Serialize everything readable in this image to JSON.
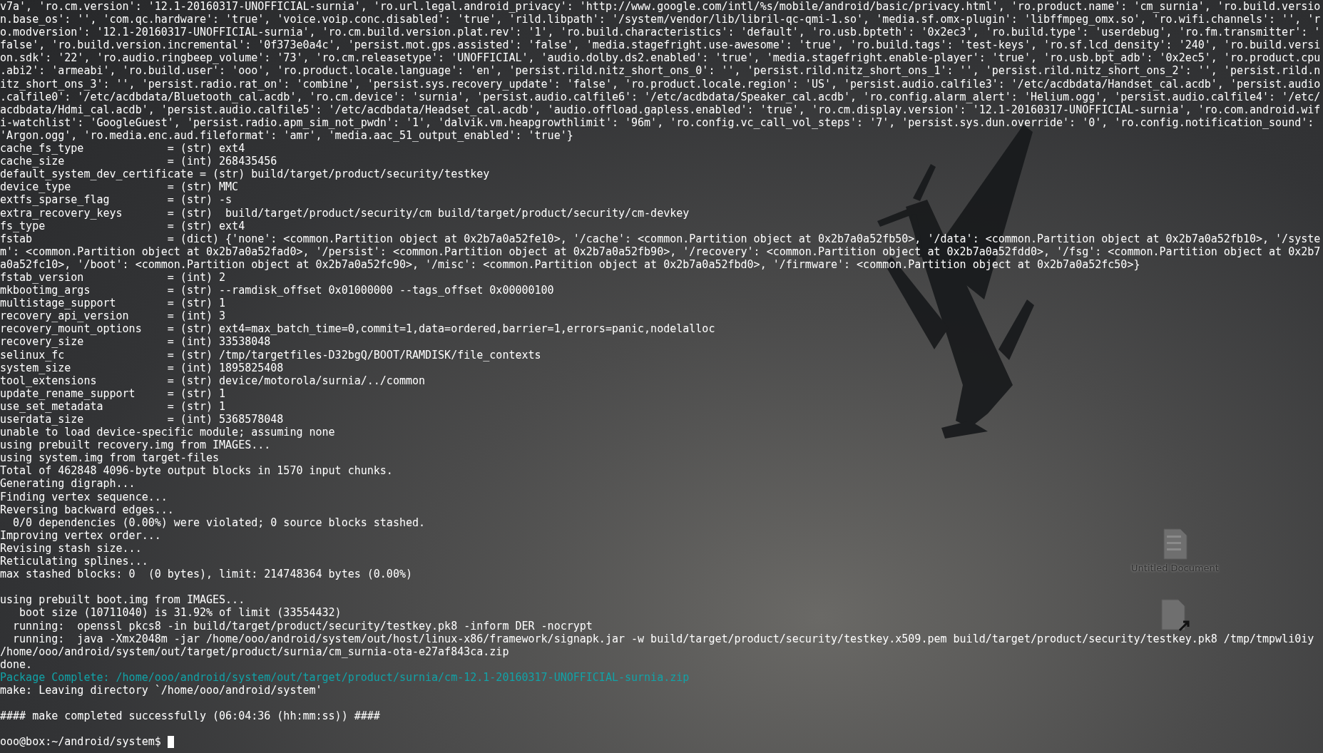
{
  "desktop": {
    "icons": [
      {
        "kind": "text-file",
        "label": "Untitled Document"
      },
      {
        "kind": "link-file"
      }
    ]
  },
  "terminal": {
    "lines": [
      {
        "kind": "plain",
        "text": "v7a', 'ro.cm.version': '12.1-20160317-UNOFFICIAL-surnia', 'ro.url.legal.android_privacy': 'http://www.google.com/intl/%s/mobile/android/basic/privacy.html', 'ro.product.name': 'cm_surnia', 'ro.build.versio"
      },
      {
        "kind": "plain",
        "text": "n.base_os': '', 'com.qc.hardware': 'true', 'voice.voip.conc.disabled': 'true', 'rild.libpath': '/system/vendor/lib/libril-qc-qmi-1.so', 'media.sf.omx-plugin': 'libffmpeg_omx.so', 'ro.wifi.channels': '', 'r"
      },
      {
        "kind": "plain",
        "text": "o.modversion': '12.1-20160317-UNOFFICIAL-surnia', 'ro.cm.build.version.plat.rev': '1', 'ro.build.characteristics': 'default', 'ro.usb.bpteth': '0x2ec3', 'ro.build.type': 'userdebug', 'ro.fm.transmitter': '"
      },
      {
        "kind": "plain",
        "text": "false', 'ro.build.version.incremental': '0f373e0a4c', 'persist.mot.gps.assisted': 'false', 'media.stagefright.use-awesome': 'true', 'ro.build.tags': 'test-keys', 'ro.sf.lcd_density': '240', 'ro.build.versi"
      },
      {
        "kind": "plain",
        "text": "on.sdk': '22', 'ro.audio.ringbeep_volume': '73', 'ro.cm.releasetype': 'UNOFFICIAL', 'audio.dolby.ds2.enabled': 'true', 'media.stagefright.enable-player': 'true', 'ro.usb.bpt_adb': '0x2ec5', 'ro.product.cpu"
      },
      {
        "kind": "plain",
        "text": ".abi2': 'armeabi', 'ro.build.user': 'ooo', 'ro.product.locale.language': 'en', 'persist.rild.nitz_short_ons_0': '', 'persist.rild.nitz_short_ons_1': '', 'persist.rild.nitz_short_ons_2': '', 'persist.rild.n"
      },
      {
        "kind": "plain",
        "text": "itz_short_ons_3': '', 'persist.radio.rat_on': 'combine', 'persist.sys.recovery_update': 'false', 'ro.product.locale.region': 'US', 'persist.audio.calfile3': '/etc/acdbdata/Handset_cal.acdb', 'persist.audio"
      },
      {
        "kind": "plain",
        "text": ".calfile0': '/etc/acdbdata/Bluetooth_cal.acdb', 'ro.cm.device': 'surnia', 'persist.audio.calfile6': '/etc/acdbdata/Speaker_cal.acdb', 'ro.config.alarm_alert': 'Helium.ogg', 'persist.audio.calfile4': '/etc/"
      },
      {
        "kind": "plain",
        "text": "acdbdata/Hdmi_cal.acdb', 'persist.audio.calfile5': '/etc/acdbdata/Headset_cal.acdb', 'audio.offload.gapless.enabled': 'true', 'ro.cm.display.version': '12.1-20160317-UNOFFICIAL-surnia', 'ro.com.android.wif"
      },
      {
        "kind": "plain",
        "text": "i-watchlist': 'GoogleGuest', 'persist.radio.apm_sim_not_pwdn': '1', 'dalvik.vm.heapgrowthlimit': '96m', 'ro.config.vc_call_vol_steps': '7', 'persist.sys.dun.override': '0', 'ro.config.notification_sound':"
      },
      {
        "kind": "plain",
        "text": "'Argon.ogg', 'ro.media.enc.aud.fileformat': 'amr', 'media.aac_51_output_enabled': 'true'}"
      },
      {
        "kind": "plain",
        "text": "cache_fs_type             = (str) ext4"
      },
      {
        "kind": "plain",
        "text": "cache_size                = (int) 268435456"
      },
      {
        "kind": "plain",
        "text": "default_system_dev_certificate = (str) build/target/product/security/testkey"
      },
      {
        "kind": "plain",
        "text": "device_type               = (str) MMC"
      },
      {
        "kind": "plain",
        "text": "extfs_sparse_flag         = (str) -s"
      },
      {
        "kind": "plain",
        "text": "extra_recovery_keys       = (str)  build/target/product/security/cm build/target/product/security/cm-devkey"
      },
      {
        "kind": "plain",
        "text": "fs_type                   = (str) ext4"
      },
      {
        "kind": "plain",
        "text": "fstab                     = (dict) {'none': <common.Partition object at 0x2b7a0a52fe10>, '/cache': <common.Partition object at 0x2b7a0a52fb50>, '/data': <common.Partition object at 0x2b7a0a52fb10>, '/syste"
      },
      {
        "kind": "plain",
        "text": "m': <common.Partition object at 0x2b7a0a52fad0>, '/persist': <common.Partition object at 0x2b7a0a52fb90>, '/recovery': <common.Partition object at 0x2b7a0a52fdd0>, '/fsg': <common.Partition object at 0x2b7"
      },
      {
        "kind": "plain",
        "text": "a0a52fc10>, '/boot': <common.Partition object at 0x2b7a0a52fc90>, '/misc': <common.Partition object at 0x2b7a0a52fbd0>, '/firmware': <common.Partition object at 0x2b7a0a52fc50>}"
      },
      {
        "kind": "plain",
        "text": "fstab_version             = (int) 2"
      },
      {
        "kind": "plain",
        "text": "mkbootimg_args            = (str) --ramdisk_offset 0x01000000 --tags_offset 0x00000100"
      },
      {
        "kind": "plain",
        "text": "multistage_support        = (str) 1"
      },
      {
        "kind": "plain",
        "text": "recovery_api_version      = (int) 3"
      },
      {
        "kind": "plain",
        "text": "recovery_mount_options    = (str) ext4=max_batch_time=0,commit=1,data=ordered,barrier=1,errors=panic,nodelalloc"
      },
      {
        "kind": "plain",
        "text": "recovery_size             = (int) 33538048"
      },
      {
        "kind": "plain",
        "text": "selinux_fc                = (str) /tmp/targetfiles-D32bgQ/BOOT/RAMDISK/file_contexts"
      },
      {
        "kind": "plain",
        "text": "system_size               = (int) 1895825408"
      },
      {
        "kind": "plain",
        "text": "tool_extensions           = (str) device/motorola/surnia/../common"
      },
      {
        "kind": "plain",
        "text": "update_rename_support     = (str) 1"
      },
      {
        "kind": "plain",
        "text": "use_set_metadata          = (str) 1"
      },
      {
        "kind": "plain",
        "text": "userdata_size             = (int) 5368578048"
      },
      {
        "kind": "plain",
        "text": "unable to load device-specific module; assuming none"
      },
      {
        "kind": "plain",
        "text": "using prebuilt recovery.img from IMAGES..."
      },
      {
        "kind": "plain",
        "text": "using system.img from target-files"
      },
      {
        "kind": "plain",
        "text": "Total of 462848 4096-byte output blocks in 1570 input chunks."
      },
      {
        "kind": "plain",
        "text": "Generating digraph..."
      },
      {
        "kind": "plain",
        "text": "Finding vertex sequence..."
      },
      {
        "kind": "plain",
        "text": "Reversing backward edges..."
      },
      {
        "kind": "plain",
        "text": "  0/0 dependencies (0.00%) were violated; 0 source blocks stashed."
      },
      {
        "kind": "plain",
        "text": "Improving vertex order..."
      },
      {
        "kind": "plain",
        "text": "Revising stash size..."
      },
      {
        "kind": "plain",
        "text": "Reticulating splines..."
      },
      {
        "kind": "plain",
        "text": "max stashed blocks: 0  (0 bytes), limit: 214748364 bytes (0.00%)"
      },
      {
        "kind": "blank"
      },
      {
        "kind": "plain",
        "text": "using prebuilt boot.img from IMAGES..."
      },
      {
        "kind": "plain",
        "text": "   boot size (10711040) is 31.92% of limit (33554432)"
      },
      {
        "kind": "plain",
        "text": "  running:  openssl pkcs8 -in build/target/product/security/testkey.pk8 -inform DER -nocrypt"
      },
      {
        "kind": "plain",
        "text": "  running:  java -Xmx2048m -jar /home/ooo/android/system/out/host/linux-x86/framework/signapk.jar -w build/target/product/security/testkey.x509.pem build/target/product/security/testkey.pk8 /tmp/tmpwli0iy"
      },
      {
        "kind": "plain",
        "text": "/home/ooo/android/system/out/target/product/surnia/cm_surnia-ota-e27af843ca.zip"
      },
      {
        "kind": "plain",
        "text": "done."
      },
      {
        "kind": "success",
        "text": "Package Complete: /home/ooo/android/system/out/target/product/surnia/cm-12.1-20160317-UNOFFICIAL-surnia.zip"
      },
      {
        "kind": "plain",
        "text": "make: Leaving directory `/home/ooo/android/system'"
      },
      {
        "kind": "blank"
      },
      {
        "kind": "plain",
        "text": "#### make completed successfully (06:04:36 (hh:mm:ss)) ####"
      },
      {
        "kind": "blank"
      }
    ],
    "prompt": {
      "text": "ooo@box:~/android/system$"
    }
  }
}
